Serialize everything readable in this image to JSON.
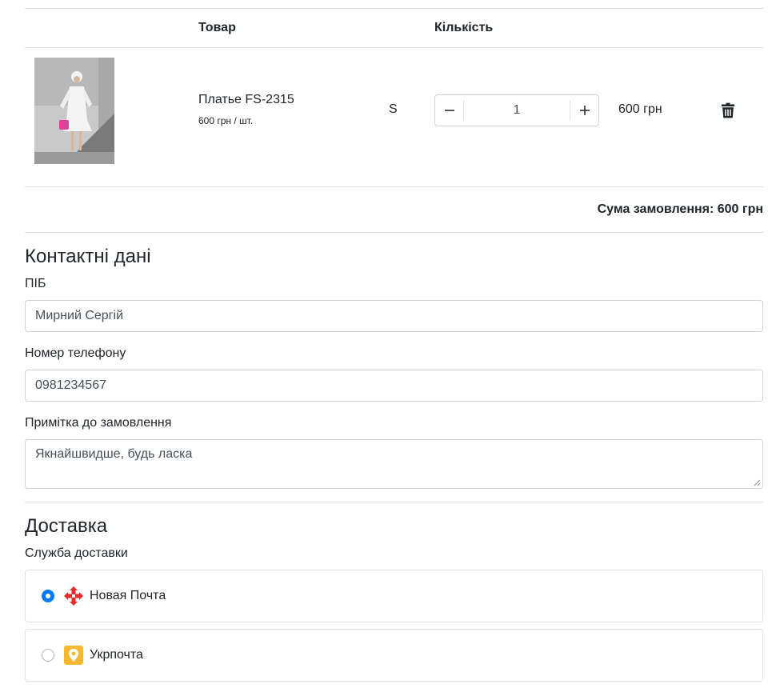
{
  "cart": {
    "headers": {
      "product": "Товар",
      "quantity": "Кількість"
    },
    "items": [
      {
        "name": "Платье FS-2315",
        "unit_price": "600 грн / шт.",
        "size": "S",
        "quantity": "1",
        "total": "600 грн",
        "decrease_icon": "minus-icon",
        "increase_icon": "plus-icon",
        "delete_icon": "trash-icon"
      }
    ],
    "order_sum": "Сума замовлення: 600 грн"
  },
  "contact": {
    "title": "Контактні дані",
    "name_label": "ПІБ",
    "name_value": "Мирний Сергій",
    "phone_label": "Номер телефону",
    "phone_value": "0981234567",
    "note_label": "Примітка до замовлення",
    "note_value": "Якнайшвидше, будь ласка"
  },
  "delivery": {
    "title": "Доставка",
    "service_label": "Служба доставки",
    "options": [
      {
        "label": "Новая Почта",
        "selected": true,
        "icon": "nova-poshta-logo-icon",
        "color": "#e52b2b"
      },
      {
        "label": "Укрпочта",
        "selected": false,
        "icon": "ukrposhta-logo-icon",
        "color": "#f7b731"
      }
    ]
  },
  "colors": {
    "accent": "#007bff",
    "border": "#ced4da",
    "divider": "#dee2e6"
  }
}
